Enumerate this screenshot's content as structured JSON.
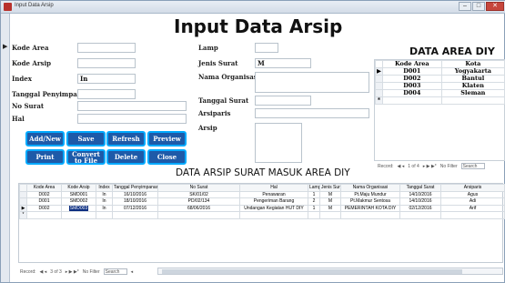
{
  "window": {
    "title": "Input Data Arsip",
    "controls": [
      "–",
      "□",
      "✕"
    ]
  },
  "heading": "Input Data Arsip",
  "form": {
    "kode_area": {
      "label": "Kode Area",
      "value": ""
    },
    "kode_arsip": {
      "label": "Kode Arsip",
      "value": ""
    },
    "index": {
      "label": "Index",
      "value": "In"
    },
    "tanggal_penyimpanan": {
      "label": "Tanggal Penyimpanan",
      "value": ""
    },
    "no_surat": {
      "label": "No Surat",
      "value": ""
    },
    "hal": {
      "label": "Hal",
      "value": ""
    },
    "lamp": {
      "label": "Lamp",
      "value": ""
    },
    "jenis_surat": {
      "label": "Jenis Surat",
      "value": "M"
    },
    "nama_organisasi": {
      "label": "Nama Organisasi",
      "value": ""
    },
    "tanggal_surat": {
      "label": "Tanggal Surat",
      "value": ""
    },
    "arsiparis": {
      "label": "Arsiparis",
      "value": ""
    },
    "arsip": {
      "label": "Arsip",
      "value": ""
    }
  },
  "buttons": {
    "add_new": "Add/New",
    "save": "Save",
    "refresh": "Refresh",
    "preview": "Preview",
    "print": "Print",
    "convert": "Convert to File",
    "delete": "Delete",
    "close": "Close"
  },
  "diy": {
    "title": "DATA AREA DIY",
    "headers": [
      "Kode Area",
      "Kota"
    ],
    "rows": [
      {
        "kode": "D001",
        "kota": "Yogyakarta"
      },
      {
        "kode": "D002",
        "kota": "Bantul"
      },
      {
        "kode": "D003",
        "kota": "Klaten"
      },
      {
        "kode": "D004",
        "kota": "Sleman"
      }
    ],
    "nav": {
      "record_label": "Record:",
      "position": "1 of 4",
      "filter": "No Filter",
      "search": "Search"
    }
  },
  "grid": {
    "title": "DATA ARSIP SURAT MASUK AREA DIY",
    "headers": [
      "Kode Area",
      "Kode Arsip",
      "Index",
      "Tanggal Penyimpanan",
      "No Surat",
      "Hal",
      "Lamp",
      "Jenis Surat",
      "Nama Organisasi",
      "Tanggal Surat",
      "Arsiparis"
    ],
    "rows": [
      [
        "D002",
        "SMD001",
        "In",
        "16/10/2016",
        "SK/01/02",
        "Penawaran",
        "1",
        "M",
        "Pt.Maju Mundur",
        "14/10/2016",
        "Agus"
      ],
      [
        "D001",
        "SMD002",
        "In",
        "18/10/2016",
        "PD/02/134",
        "Pengeriman Barang",
        "2",
        "M",
        "Pt.Makmur Sentosa",
        "14/10/2016",
        "Adi"
      ],
      [
        "D002",
        "SMD003",
        "In",
        "07/12/2016",
        "68/06/2016",
        "Undangan Kegiatan HUT DIY",
        "1",
        "M",
        "PEMERINTAH KOTA DIY",
        "02/12/2016",
        "Arif"
      ]
    ],
    "nav": {
      "record_label": "Record:",
      "position": "3 of 3",
      "filter": "No Filter",
      "search": "Search"
    }
  }
}
